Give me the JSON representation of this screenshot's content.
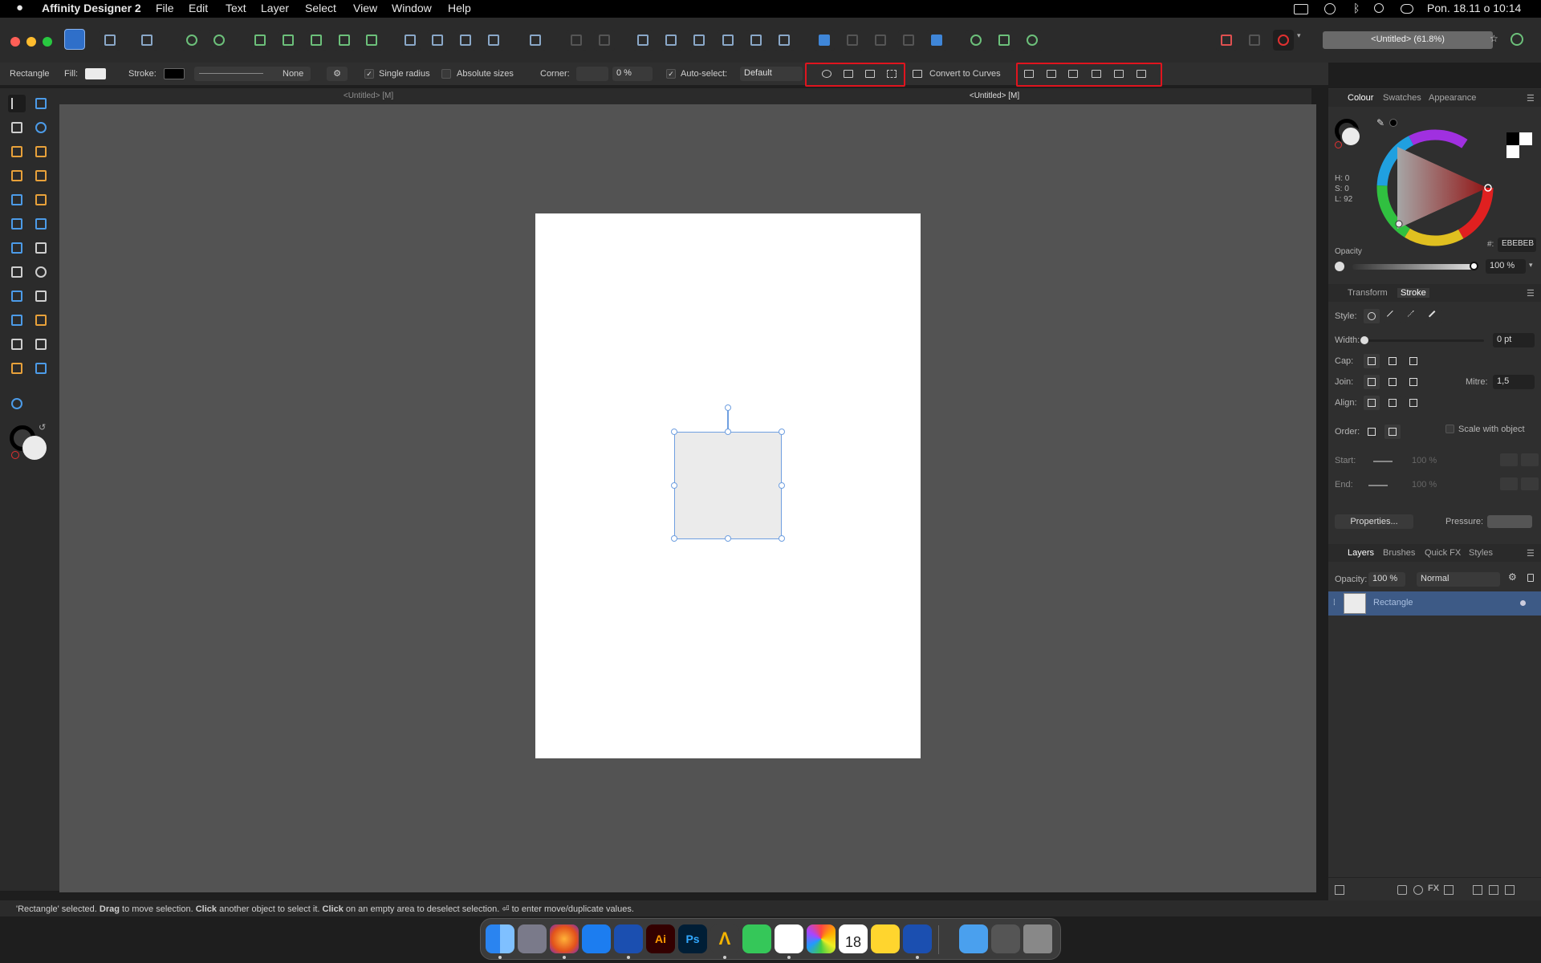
{
  "menubar": {
    "app_name": "Affinity Designer 2",
    "items": [
      "File",
      "Edit",
      "Text",
      "Layer",
      "Select",
      "View",
      "Window",
      "Help"
    ],
    "datetime": "Pon. 18.11 o 10:14"
  },
  "toolbar": {
    "doc_title": "<Untitled> (61.8%)"
  },
  "context": {
    "tool_name": "Rectangle",
    "fill_label": "Fill:",
    "stroke_label": "Stroke:",
    "stroke_value": "None",
    "single_radius": "Single radius",
    "absolute_sizes": "Absolute sizes",
    "corner_label": "Corner:",
    "corner_value": "0 %",
    "auto_select_label": "Auto-select:",
    "auto_select_value": "Default",
    "convert_to_curves": "Convert to Curves"
  },
  "doc_tabs": [
    "<Untitled> [M]",
    "<Untitled> [M]"
  ],
  "colour_panel": {
    "tabs": [
      "Colour",
      "Swatches",
      "Appearance"
    ],
    "h": "H: 0",
    "s": "S: 0",
    "l": "L: 92",
    "hex_prefix": "#:",
    "hex": "EBEBEB",
    "opacity_label": "Opacity",
    "opacity_value": "100 %"
  },
  "stroke_panel": {
    "tabs": [
      "Transform",
      "Stroke"
    ],
    "style_label": "Style:",
    "width_label": "Width:",
    "width_value": "0 pt",
    "cap_label": "Cap:",
    "join_label": "Join:",
    "mitre_label": "Mitre:",
    "mitre_value": "1,5",
    "align_label": "Align:",
    "order_label": "Order:",
    "scale_with_object": "Scale with object",
    "start_label": "Start:",
    "start_value": "100 %",
    "end_label": "End:",
    "end_value": "100 %",
    "properties_button": "Properties...",
    "pressure_label": "Pressure:"
  },
  "layers_panel": {
    "tabs": [
      "Layers",
      "Brushes",
      "Quick FX",
      "Styles"
    ],
    "opacity_label": "Opacity:",
    "opacity_value": "100 %",
    "blend_mode": "Normal",
    "layer_name": "Rectangle"
  },
  "statusbar": {
    "p1": "'Rectangle' selected.",
    "drag": "Drag",
    "p2": "to move selection.",
    "click1": "Click",
    "p3": "another object to select it.",
    "click2": "Click",
    "p4": "on an empty area to deselect selection.",
    "p5": "⏎ to enter move/duplicate values."
  },
  "dock": {
    "ai": "Ai",
    "ps": "Ps",
    "calendar_day": "18"
  },
  "colors": {
    "accent": "#3f86d8",
    "selection": "#6f9fe0",
    "highlight_box": "#e0141e",
    "rect_fill": "#EBEBEB"
  }
}
